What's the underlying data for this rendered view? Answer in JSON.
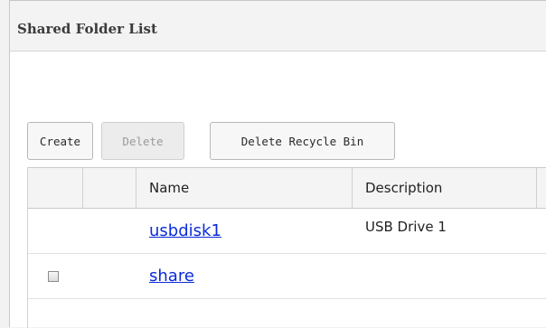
{
  "panel": {
    "title": "Shared Folder List"
  },
  "toolbar": {
    "create_label": "Create",
    "delete_label": "Delete",
    "delete_recycle_label": "Delete Recycle Bin"
  },
  "table": {
    "columns": [
      "",
      "",
      "Name",
      "Description"
    ],
    "rows": [
      {
        "name": "usbdisk1",
        "description": "USB Drive 1",
        "has_checkbox": false
      },
      {
        "name": "share",
        "description": "",
        "has_checkbox": true
      }
    ]
  },
  "colors": {
    "link": "#0a2bd8",
    "header_bg": "#f3f3f3"
  }
}
